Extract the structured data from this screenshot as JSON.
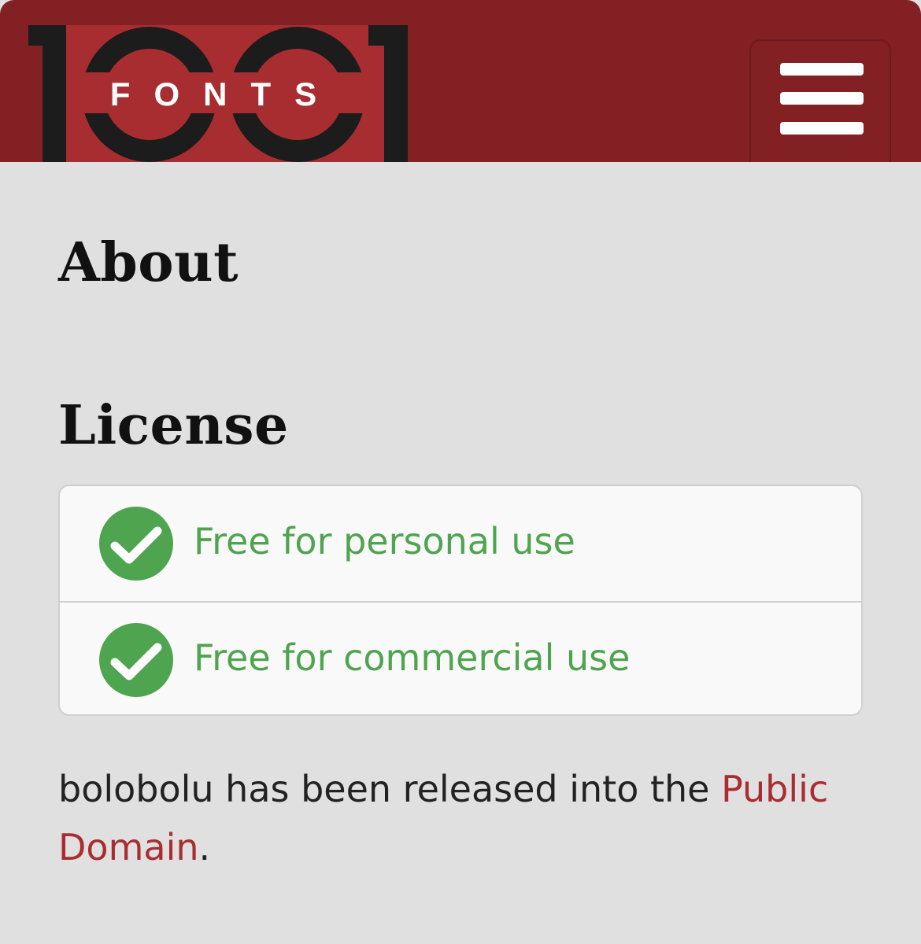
{
  "header": {
    "logo_text": "FONTS",
    "logo_numerals": "1001",
    "menu_icon": "hamburger-menu-icon"
  },
  "colors": {
    "header_bg": "#822023",
    "logo_red": "#a82d30",
    "logo_black": "#1c1c1c",
    "page_bg": "#e0e0e0",
    "license_green": "#4fa44f",
    "link_red": "#a82d30"
  },
  "about": {
    "heading": "About"
  },
  "license": {
    "heading": "License",
    "items": [
      {
        "label": "Free for personal use",
        "icon": "check-circle-icon"
      },
      {
        "label": "Free for commercial use",
        "icon": "check-circle-icon"
      }
    ],
    "description_prefix": "bolobolu has been released into the ",
    "link_text": "Public Domain",
    "description_suffix": "."
  }
}
